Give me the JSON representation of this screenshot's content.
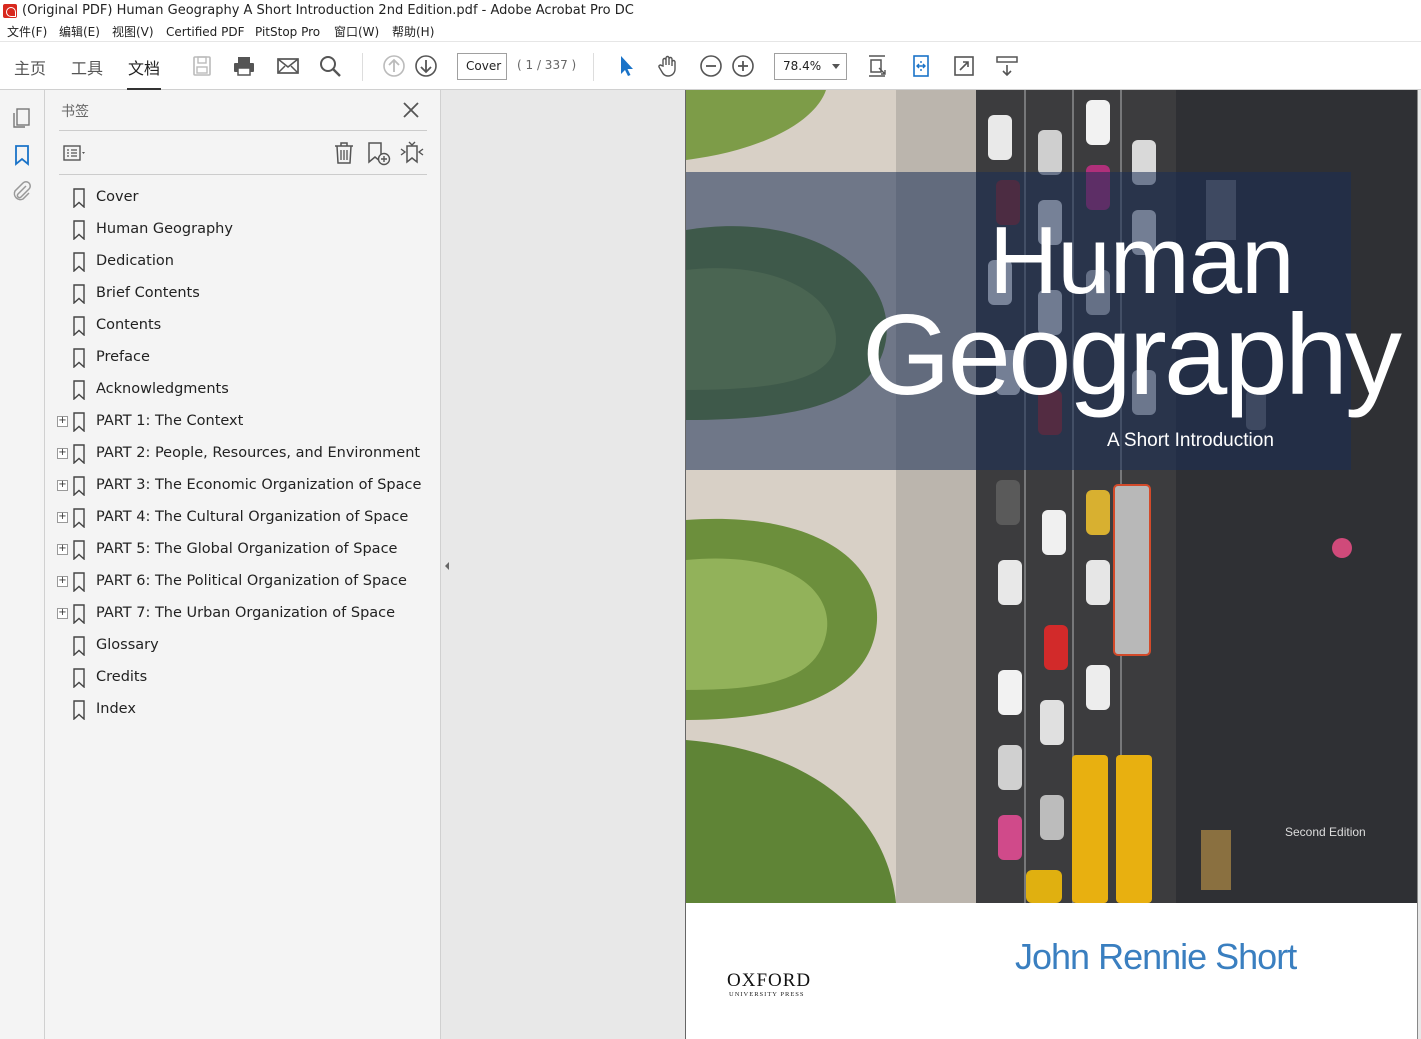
{
  "window": {
    "title": "(Original PDF) Human Geography A Short Introduction 2nd Edition.pdf - Adobe Acrobat Pro DC"
  },
  "menu": {
    "items": [
      "文件(F)",
      "编辑(E)",
      "视图(V)",
      "Certified PDF",
      "PitStop Pro",
      "窗口(W)",
      "帮助(H)"
    ]
  },
  "toolbar": {
    "tabs": [
      "主页",
      "工具",
      "文档"
    ],
    "active_tab": "文档",
    "page_label": "Cover",
    "page_count": "( 1 / 337 )",
    "zoom": "78.4%",
    "icons": [
      "save-icon",
      "print-icon",
      "email-icon",
      "search-icon",
      "prev-page-icon",
      "next-page-icon",
      "select-cursor-icon",
      "hand-tool-icon",
      "zoom-out-icon",
      "zoom-in-icon",
      "fit-page-icon",
      "fit-width-icon",
      "fullscreen-icon",
      "read-mode-icon"
    ],
    "accent_color": "#1a73c8"
  },
  "sidebar": {
    "rail_icons": [
      "pages-icon",
      "bookmark-icon",
      "attachment-icon"
    ],
    "panel_title": "书签",
    "bookmarks": [
      {
        "label": "Cover",
        "expandable": false
      },
      {
        "label": "Human Geography",
        "expandable": false
      },
      {
        "label": "Dedication",
        "expandable": false
      },
      {
        "label": "Brief Contents",
        "expandable": false
      },
      {
        "label": "Contents",
        "expandable": false
      },
      {
        "label": "Preface",
        "expandable": false
      },
      {
        "label": "Acknowledgments",
        "expandable": false
      },
      {
        "label": "PART 1: The Context",
        "expandable": true
      },
      {
        "label": "PART 2: People, Resources, and Environment",
        "expandable": true
      },
      {
        "label": "PART 3: The Economic Organization of Space",
        "expandable": true
      },
      {
        "label": "PART 4: The Cultural Organization of Space",
        "expandable": true
      },
      {
        "label": "PART 5: The Global Organization of Space",
        "expandable": true
      },
      {
        "label": "PART 6: The Political Organization of Space",
        "expandable": true
      },
      {
        "label": "PART 7: The Urban Organization of Space",
        "expandable": true
      },
      {
        "label": "Glossary",
        "expandable": false
      },
      {
        "label": "Credits",
        "expandable": false
      },
      {
        "label": "Index",
        "expandable": false
      }
    ]
  },
  "document": {
    "cover": {
      "title_line1": "Human",
      "title_line2": "Geography",
      "subtitle": "A Short Introduction",
      "edition": "Second Edition",
      "author": "John Rennie Short",
      "publisher": "OXFORD",
      "publisher_sub": "UNIVERSITY PRESS",
      "author_color": "#3a7fc0"
    }
  }
}
